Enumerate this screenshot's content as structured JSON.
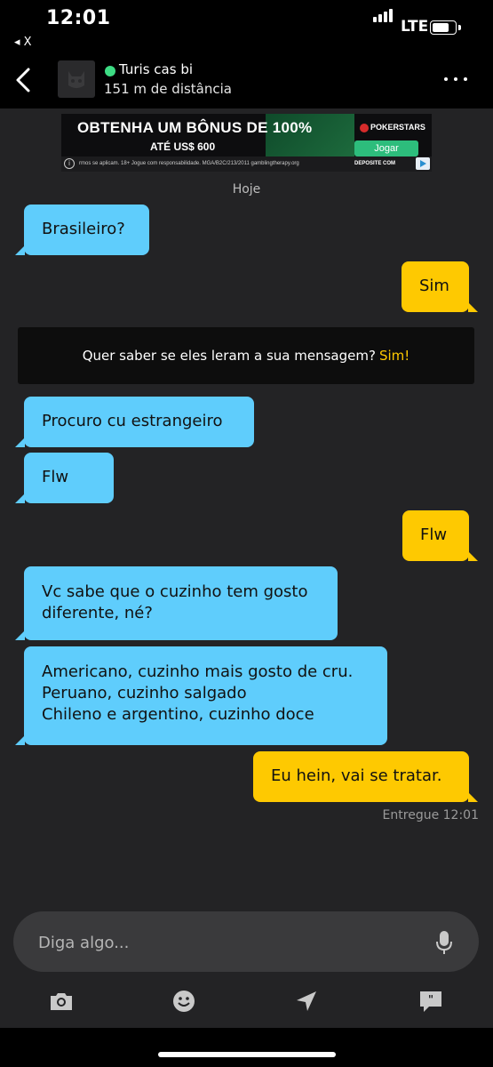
{
  "status_bar": {
    "time": "12:01",
    "back_app": "◂ X",
    "network": "LTE",
    "signal_bars": 4,
    "battery_level": 0.75
  },
  "header": {
    "contact_name": "Turis cas bi",
    "distance": "151 m de distância",
    "online": true,
    "online_color": "#3ddc84",
    "back_icon": "chevron-left-icon",
    "more_icon": "more-horizontal-icon"
  },
  "ad": {
    "headline": "OBTENHA UM BÔNUS DE 100%",
    "subline": "ATÉ US$ 600",
    "brand": "POKERSTARS",
    "cta": "Jogar",
    "disclaimer": "rmos se aplicam. 18+ Jogue com responsabilidade. MGA/B2C/213/2011 gamblingtherapy.org",
    "deposit_text": "DEPOSITE COM"
  },
  "date_separator": "Hoje",
  "messages": [
    {
      "direction": "in",
      "text": "Brasileiro?"
    },
    {
      "direction": "out",
      "text": "Sim"
    },
    {
      "direction": "in",
      "text": "Procuro cu estrangeiro"
    },
    {
      "direction": "in",
      "text": "Flw"
    },
    {
      "direction": "out",
      "text": "Flw"
    },
    {
      "direction": "in",
      "text": "Vc sabe que o cuzinho tem gosto\ndiferente,  né?"
    },
    {
      "direction": "in",
      "text": "Americano, cuzinho mais gosto de cru.\nPeruano, cuzinho salgado\nChileno e argentino, cuzinho doce"
    },
    {
      "direction": "out",
      "text": "Eu hein, vai se tratar."
    }
  ],
  "read_receipt_notice": {
    "text": "Quer saber se eles leram a sua mensagem?",
    "cta": "Sim!"
  },
  "delivery_status": "Entregue 12:01",
  "composer": {
    "placeholder": "Diga algo...",
    "mic_icon": "microphone-icon"
  },
  "toolbar": {
    "icons": [
      "camera-icon",
      "emoji-icon",
      "location-arrow-icon",
      "saved-phrases-icon"
    ]
  },
  "colors": {
    "background": "#232325",
    "incoming_bubble": "#5fcdfc",
    "outgoing_bubble": "#fec901",
    "accent": "#fec901"
  }
}
